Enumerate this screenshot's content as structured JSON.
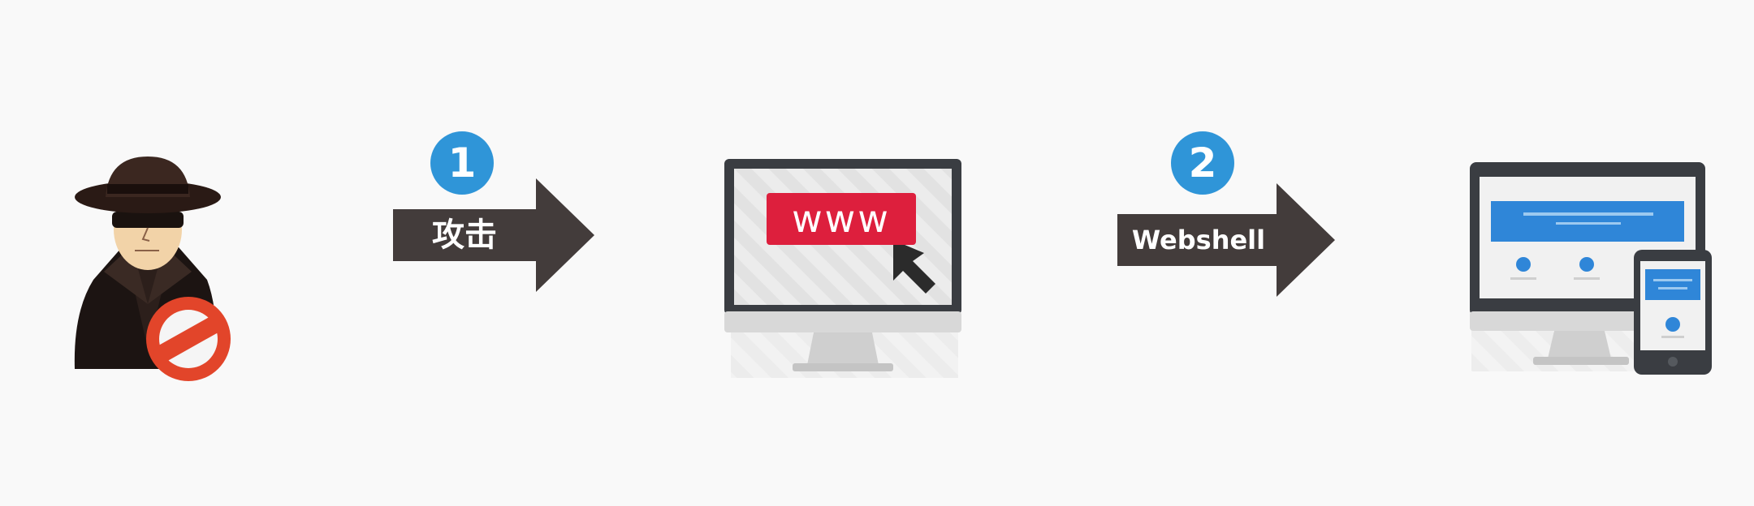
{
  "steps": [
    {
      "number": "1",
      "label": "攻击"
    },
    {
      "number": "2",
      "label": "Webshell"
    }
  ],
  "browser": {
    "text": "www"
  },
  "colors": {
    "background": "#f9f9f9",
    "badge": "#2f95d8",
    "arrow": "#433c3b",
    "www_button": "#dd1f3d",
    "no_sign": "#e2452a"
  },
  "icons": {
    "attacker": "hacker-in-hat-icon",
    "forbidden": "no-entry-icon",
    "target": "monitor-with-www-icon",
    "result": "desktop-and-mobile-website-icon"
  }
}
